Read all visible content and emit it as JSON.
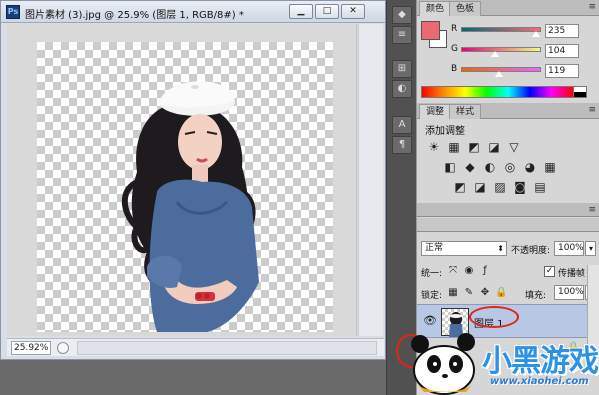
{
  "document": {
    "app_badge": "Ps",
    "title": "图片素材 (3).jpg @ 25.9% (图层 1, RGB/8#) *",
    "minimize_label": "▁",
    "restore_label": "□",
    "close_label": "✕",
    "zoom": "25.92%"
  },
  "dock": {
    "buttons": [
      "◆",
      "≡",
      "⊞",
      "◐",
      "A",
      "¶"
    ]
  },
  "color_panel": {
    "tabs": [
      "颜色",
      "色板"
    ],
    "foreground": "#eb6877",
    "background": "#ffffff",
    "channels": [
      {
        "label": "R",
        "value": "235"
      },
      {
        "label": "G",
        "value": "104"
      },
      {
        "label": "B",
        "value": "119"
      }
    ]
  },
  "adjustments_panel": {
    "tabs": [
      "调整",
      "样式"
    ],
    "title": "添加调整",
    "icons_row1": [
      "☀",
      "▦",
      "◩",
      "◪",
      "▽"
    ],
    "icons_row2": [
      "◧",
      "◆",
      "◐",
      "◎",
      "◕",
      "▦"
    ],
    "icons_row3": [
      "◩",
      "◪",
      "▨",
      "◙",
      "▤"
    ]
  },
  "layers_panel": {
    "blend_mode": "正常",
    "opacity_label": "不透明度:",
    "opacity_value": "100%",
    "unify_label": "统一:",
    "propagate_label": "传播帧 1",
    "lock_label": "锁定:",
    "fill_label": "填充:",
    "fill_value": "100%",
    "layer_name": "图层 1"
  },
  "watermark": {
    "brand": "小黑游戏",
    "url": "www.xiaohei.com"
  }
}
